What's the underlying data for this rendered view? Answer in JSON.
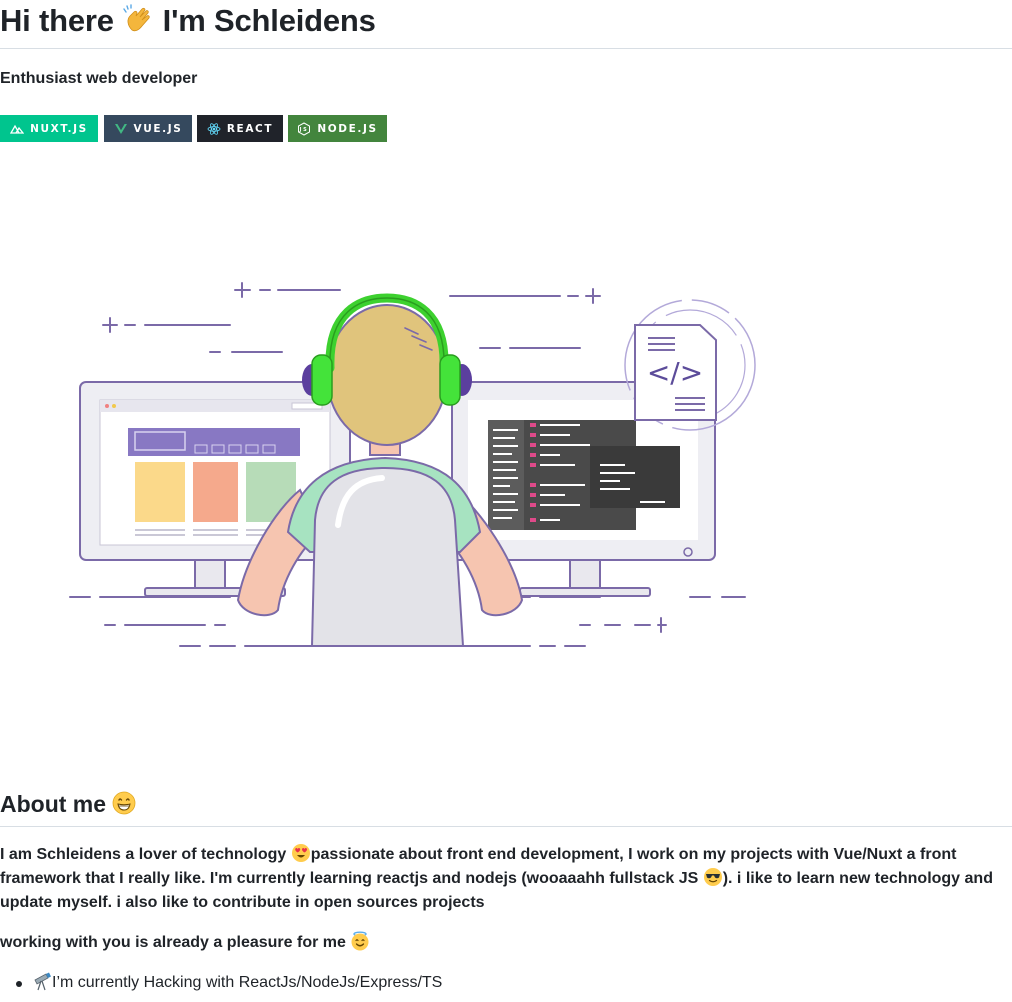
{
  "header": {
    "greeting": "Hi there",
    "wave_icon": "waving-hand-icon",
    "name": "I'm Schleidens",
    "subtitle": "Enthusiast web developer"
  },
  "badges": [
    {
      "label": "NUXT.JS",
      "icon": "nuxt-icon",
      "color": "#00C58E"
    },
    {
      "label": "VUE.JS",
      "icon": "vue-icon",
      "color": "#35495E"
    },
    {
      "label": "REACT",
      "icon": "react-icon",
      "color": "#20232A"
    },
    {
      "label": "NODE.JS",
      "icon": "nodejs-icon",
      "color": "#43853D"
    }
  ],
  "illustration": {
    "code_glyph": "</>"
  },
  "about": {
    "title": "About me",
    "title_icon": "grinning-face-icon",
    "para1_part1": "I am Schleidens a lover of technology ",
    "para1_part2": "passionate about front end development, I work on my projects with Vue/Nuxt a front",
    "para1_part3": "framework that I really like. I'm currently learning reactjs and nodejs (wooaaahh fullstack JS ",
    "para1_part4": "). i like to learn new technology and",
    "para1_part5": "update myself. i also like to contribute in open sources projects",
    "para2": "working with you is already a pleasure for me ",
    "list": [
      {
        "icon": "telescope-icon",
        "text": "I’m currently Hacking with ReactJs/NodeJs/Express/TS"
      }
    ]
  }
}
